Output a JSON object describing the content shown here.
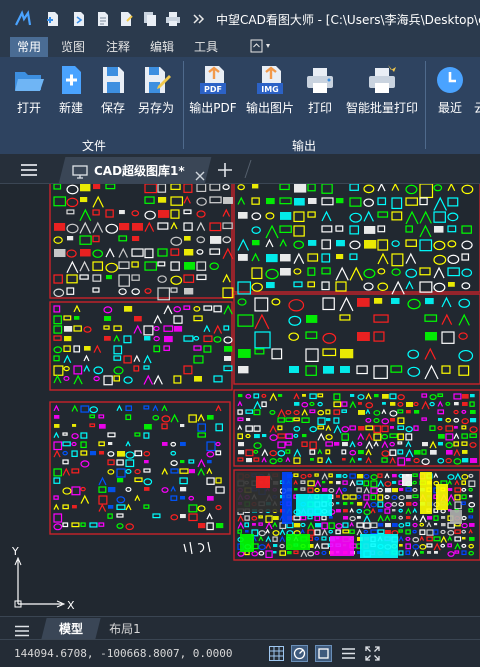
{
  "window": {
    "title": "中望CAD看图大师 - [C:\\Users\\李海兵\\Desktop\\c"
  },
  "ribbon_tabs": [
    {
      "label": "常用",
      "active": true
    },
    {
      "label": "览图",
      "active": false
    },
    {
      "label": "注释",
      "active": false
    },
    {
      "label": "编辑",
      "active": false
    },
    {
      "label": "工具",
      "active": false
    }
  ],
  "ribbon": {
    "file_group": {
      "label": "文件",
      "buttons": [
        {
          "label": "打开",
          "icon": "folder-open-icon"
        },
        {
          "label": "新建",
          "icon": "new-file-icon"
        },
        {
          "label": "保存",
          "icon": "save-icon"
        },
        {
          "label": "另存为",
          "icon": "save-as-icon"
        }
      ]
    },
    "output_group": {
      "label": "输出",
      "buttons": [
        {
          "label": "输出PDF",
          "icon": "pdf-export-icon",
          "badge": "PDF"
        },
        {
          "label": "输出图片",
          "icon": "image-export-icon",
          "badge": "IMG"
        },
        {
          "label": "打印",
          "icon": "printer-icon"
        },
        {
          "label": "智能批量打印",
          "icon": "batch-print-icon"
        }
      ]
    },
    "recent": {
      "label": "最近",
      "icon": "clock-icon"
    },
    "cut_off_label": "云"
  },
  "doc_tabs": {
    "active": "CAD超级图库1*"
  },
  "layout_tabs": [
    {
      "label": "模型",
      "active": true
    },
    {
      "label": "布局1",
      "active": false
    }
  ],
  "canvas": {
    "ucs_y": "Y",
    "ucs_x": "X"
  },
  "status": {
    "coordinates": "144094.6708, -100668.8007, 0.0000"
  },
  "colors": {
    "title_bar": "#2b3a4d",
    "ribbon": "#2e4360",
    "canvas_bg": "#212830",
    "frame_red": "#c8222a"
  }
}
